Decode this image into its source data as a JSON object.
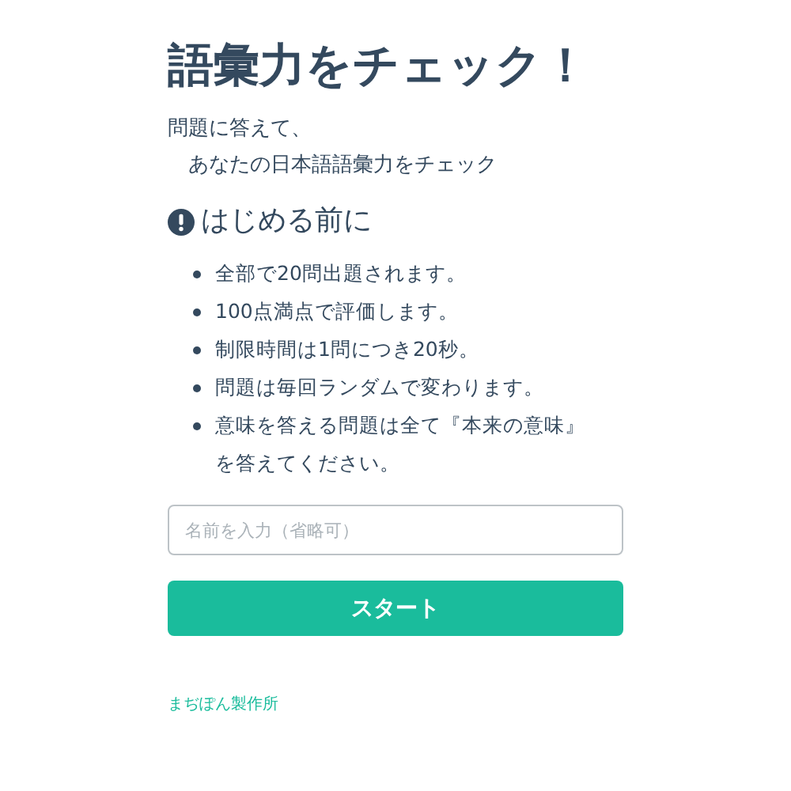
{
  "title": "語彙力をチェック！",
  "intro": [
    "問題に答えて、",
    "あなたの日本語語彙力をチェック"
  ],
  "notice": {
    "heading": "はじめる前に",
    "items": [
      "全部で20問出題されます。",
      "100点満点で評価します。",
      "制限時間は1問につき20秒。",
      "問題は毎回ランダムで変わります。",
      "意味を答える問題は全て『本来の意味』を答えてください。"
    ]
  },
  "name_field": {
    "placeholder": "名前を入力（省略可）"
  },
  "start_button": "スタート",
  "footer": "まぢぽん製作所"
}
